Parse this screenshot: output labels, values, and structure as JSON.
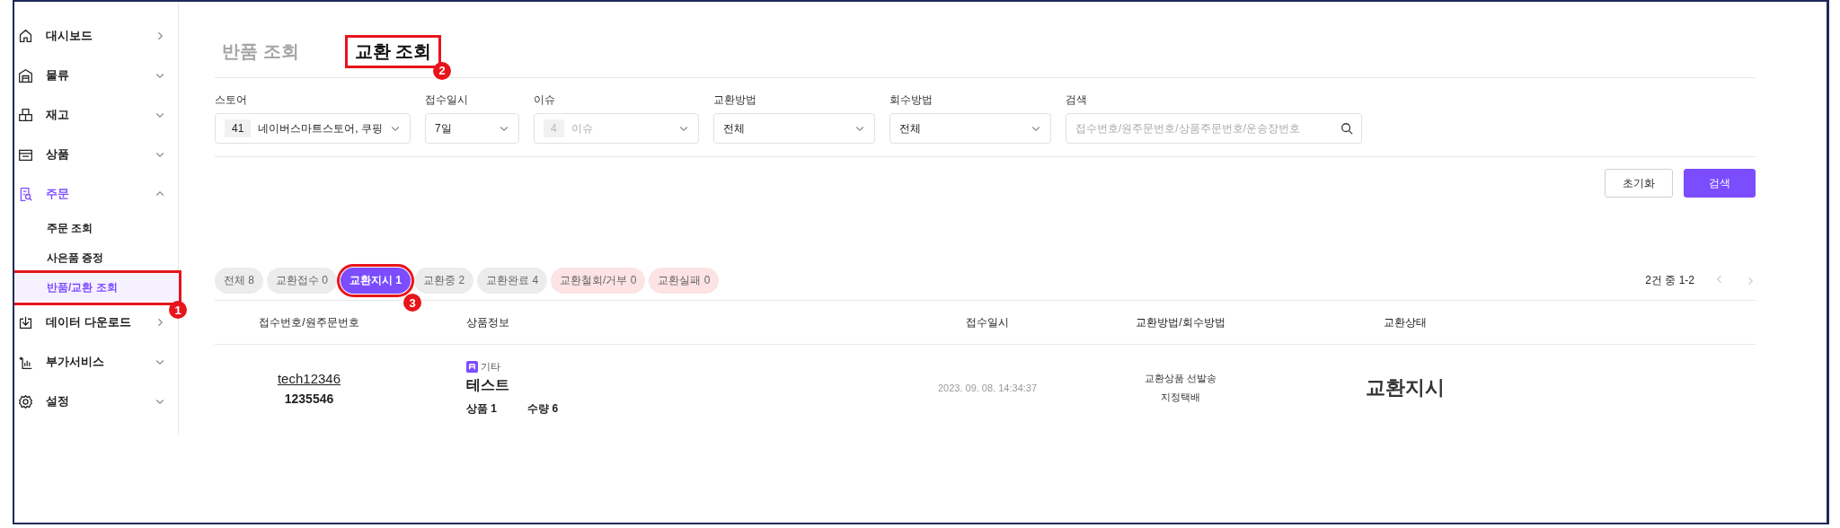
{
  "sidebar": {
    "items": [
      {
        "label": "대시보드",
        "kind": "link"
      },
      {
        "label": "물류",
        "kind": "group",
        "expanded": false
      },
      {
        "label": "재고",
        "kind": "group",
        "expanded": false
      },
      {
        "label": "상품",
        "kind": "group",
        "expanded": false
      },
      {
        "label": "주문",
        "kind": "group",
        "expanded": true,
        "children": [
          {
            "label": "주문 조회",
            "selected": false
          },
          {
            "label": "사은품 증정",
            "selected": false
          },
          {
            "label": "반품/교환 조회",
            "selected": true,
            "callout": "1"
          }
        ]
      },
      {
        "label": "데이터 다운로드",
        "kind": "link"
      },
      {
        "label": "부가서비스",
        "kind": "group",
        "expanded": false
      },
      {
        "label": "설정",
        "kind": "group",
        "expanded": false
      }
    ]
  },
  "title_tabs": [
    {
      "label": "반품 조회",
      "selected": false
    },
    {
      "label": "교환 조회",
      "selected": true,
      "callout": "2"
    }
  ],
  "filters": [
    {
      "label": "스토어",
      "kind": "select",
      "count": "41",
      "value": "네이버스마트스토어, 쿠핑"
    },
    {
      "label": "접수일시",
      "kind": "select",
      "value": "7일"
    },
    {
      "label": "이슈",
      "kind": "select",
      "count": "4",
      "placeholder": "이슈"
    },
    {
      "label": "교환방법",
      "kind": "select",
      "value": "전체"
    },
    {
      "label": "회수방법",
      "kind": "select",
      "value": "전체"
    },
    {
      "label": "검색",
      "kind": "search",
      "placeholder": "접수번호/원주문번호/상품주문번호/운송장번호"
    }
  ],
  "buttons": [
    {
      "label": "초기화",
      "kind": "secondary"
    },
    {
      "label": "검색",
      "kind": "primary"
    }
  ],
  "status_chips": [
    {
      "label": "전체 8",
      "selected": false,
      "kind": "normal"
    },
    {
      "label": "교환접수 0",
      "selected": false,
      "kind": "normal"
    },
    {
      "label": "교환지시 1",
      "selected": true,
      "kind": "normal",
      "callout": "3"
    },
    {
      "label": "교환중 2",
      "selected": false,
      "kind": "normal"
    },
    {
      "label": "교환완료 4",
      "selected": false,
      "kind": "normal"
    },
    {
      "label": "교환철회/거부 0",
      "selected": false,
      "kind": "failure"
    },
    {
      "label": "교환실패 0",
      "selected": false,
      "kind": "failure"
    }
  ],
  "pagination": {
    "summary": "2건 중 1-2"
  },
  "table": {
    "columns": [
      "접수번호/원주문번호",
      "상품정보",
      "접수일시",
      "교환방법/회수방법",
      "교환상태"
    ],
    "rows": [
      {
        "receipt_no": "tech12346",
        "order_no": "1235546",
        "tag": "기타",
        "product_name": "테스트",
        "product_label": "상품",
        "product_count": "1",
        "qty_label": "수량",
        "qty": "6",
        "received_at": "2023. 09. 08. 14:34:37",
        "exchange_method": "교환상품 선발송",
        "pickup_method": "지정택배",
        "status": "교환지시"
      }
    ]
  }
}
